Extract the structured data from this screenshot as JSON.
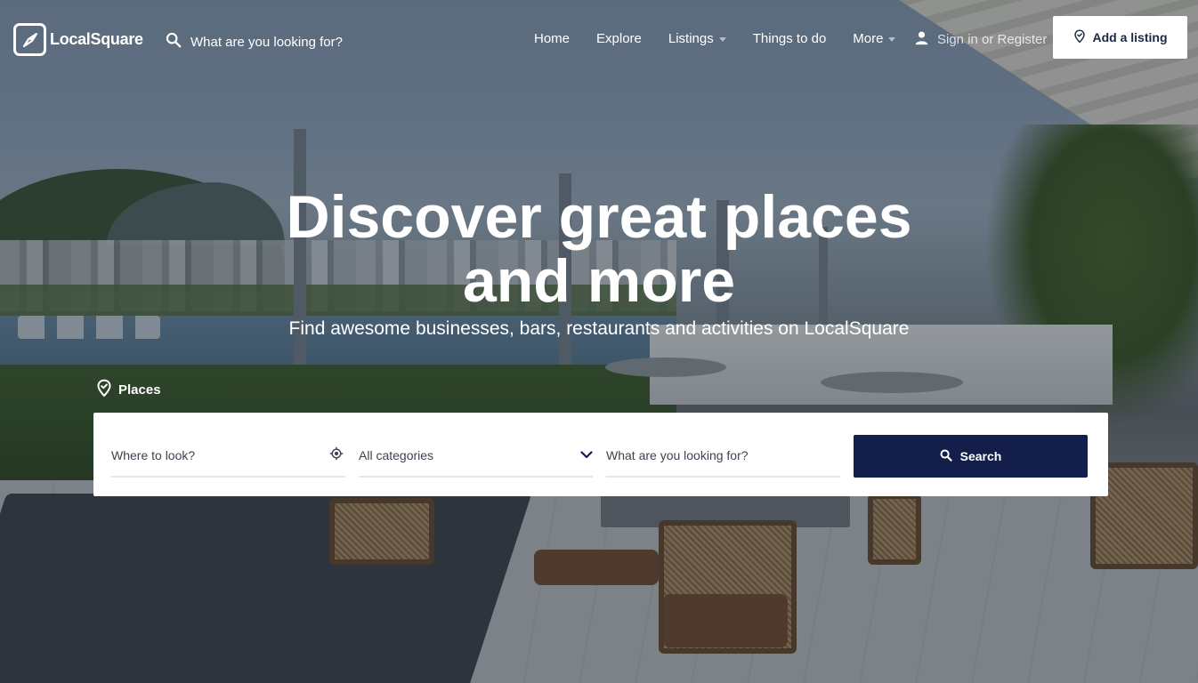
{
  "brand": {
    "name": "LocalSquare"
  },
  "header": {
    "search_placeholder": "What are you looking for?",
    "nav": [
      {
        "label": "Home",
        "has_dropdown": false
      },
      {
        "label": "Explore",
        "has_dropdown": false
      },
      {
        "label": "Listings",
        "has_dropdown": true
      },
      {
        "label": "Things to do",
        "has_dropdown": false
      },
      {
        "label": "More",
        "has_dropdown": true
      }
    ],
    "signin_label": "Sign in or Register",
    "add_listing_label": "Add a listing"
  },
  "hero": {
    "title_line1": "Discover great places",
    "title_line2": "and more",
    "subtitle": "Find awesome businesses, bars, restaurants and activities on LocalSquare"
  },
  "search_panel": {
    "tab_label": "Places",
    "location_placeholder": "Where to look?",
    "category_value": "All categories",
    "keyword_placeholder": "What are you looking for?",
    "search_button_label": "Search"
  },
  "icons": {
    "logo": "compass-icon",
    "header_search": "search-icon",
    "user": "user-icon",
    "add_listing": "map-pin-check-icon",
    "places_tab": "map-pin-check-icon",
    "locate": "crosshair-icon",
    "category_dropdown": "chevron-down-icon",
    "search_button": "search-icon"
  },
  "colors": {
    "primary": "#131f4a",
    "text_dark": "#3c4351",
    "white": "#ffffff"
  }
}
